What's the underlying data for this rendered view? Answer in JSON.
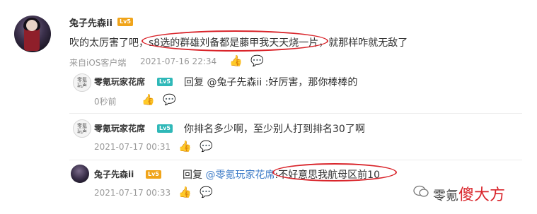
{
  "main_comment": {
    "user": "兔子先森ii",
    "badge": "Lv5",
    "text_before": "吹的太厉害了吧，",
    "text_highlight": "s8选的群雄刘备都是藤甲我天天烧一片",
    "text_after": "，就那样咋就无敌了",
    "source": "来自iOS客户端",
    "time": "2021-07-16 22:34"
  },
  "replies": [
    {
      "user": "零氪玩家花席",
      "badge": "Lv5",
      "avatar_text": "零氪\n玩声",
      "reply_label": "回复",
      "mention": "@兔子先森ii",
      "content": " :好厉害，那你棒棒的",
      "time": "0秒前"
    },
    {
      "user": "零氪玩家花席",
      "badge": "Lv5",
      "avatar_text": "零氪\n玩声",
      "content": "你排名多少啊，至少别人打到排名30了啊",
      "time": "2021-07-17 00:31"
    },
    {
      "user": "兔子先森ii",
      "badge": "Lv5",
      "reply_label": "回复",
      "mention": "@零氪玩家花席",
      "content_highlight": ":不好意思我航母区前10",
      "time": "2021-07-17 00:33"
    }
  ],
  "watermark": {
    "text": "零氪",
    "brand": "傻大方"
  },
  "colors": {
    "link": "#3d7bc7",
    "ring": "#d9252b",
    "badge_gold": "#f0a41a",
    "badge_teal": "#2fb8b8"
  }
}
